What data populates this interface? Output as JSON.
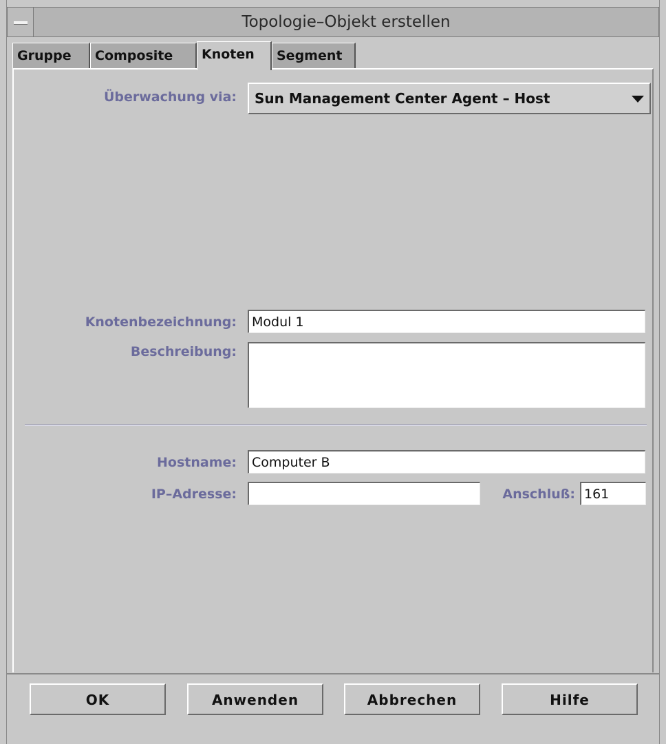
{
  "window": {
    "title": "Topologie–Objekt erstellen"
  },
  "tabs": [
    {
      "label": "Gruppe",
      "active": false
    },
    {
      "label": "Composite",
      "active": false
    },
    {
      "label": "Knoten",
      "active": true
    },
    {
      "label": "Segment",
      "active": false
    }
  ],
  "monitor": {
    "label": "Überwachung via:",
    "value": "Sun Management Center Agent – Host"
  },
  "form": {
    "node_label_label": "Knotenbezeichnung:",
    "node_label_value": "Modul 1",
    "description_label": "Beschreibung:",
    "description_value": "",
    "hostname_label": "Hostname:",
    "hostname_value": "Computer B",
    "ip_label": "IP–Adresse:",
    "ip_value": "",
    "port_label": "Anschluß:",
    "port_value": "161"
  },
  "buttons": {
    "ok": "OK",
    "apply": "Anwenden",
    "cancel": "Abbrechen",
    "help": "Hilfe"
  },
  "colors": {
    "background": "#c8c8c8",
    "label": "#6b6b9c"
  }
}
